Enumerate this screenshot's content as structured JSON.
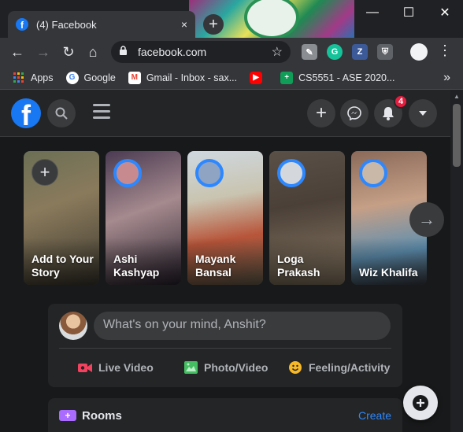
{
  "browser": {
    "tab_count_label": "(4) Facebook",
    "tab_close": "×",
    "new_tab": "+",
    "window": {
      "minimize": "—",
      "maximize": "☐",
      "close": "✕"
    },
    "nav": {
      "back": "←",
      "forward": "→",
      "reload": "↻",
      "home": "⌂"
    },
    "url": "facebook.com",
    "lock_icon": "🔒",
    "star_icon": "☆",
    "menu_icon": "⋮",
    "extensions": [
      {
        "name": "extension-1",
        "glyph": "✎",
        "color": "#8a8d91"
      },
      {
        "name": "grammarly",
        "glyph": "G",
        "color": "#15c39a"
      },
      {
        "name": "z-extension",
        "glyph": "Z",
        "color": "#3d5a98"
      },
      {
        "name": "shield-extension",
        "glyph": "⛨",
        "color": "#5f6368"
      }
    ]
  },
  "bookmarks": {
    "items": [
      {
        "label": "Apps",
        "icon": "apps-grid-icon",
        "color": "#ea4335"
      },
      {
        "label": "Google",
        "icon": "google-icon",
        "color": "#4285f4"
      },
      {
        "label": "Gmail - Inbox - sax...",
        "icon": "gmail-icon",
        "color": "#ea4335"
      },
      {
        "label": "",
        "icon": "youtube-icon",
        "color": "#ff0000"
      },
      {
        "label": "CS5551 - ASE 2020...",
        "icon": "cs-icon",
        "color": "#0f9d58"
      }
    ],
    "overflow": "»"
  },
  "facebook": {
    "logo_glyph": "f",
    "header": {
      "search_icon": "⌕",
      "create_icon": "+",
      "messenger_icon": "✉",
      "notifications_icon": "🔔",
      "notifications_count": "4",
      "account_icon": "▾"
    },
    "stories": [
      {
        "name": "Add to Your Story",
        "is_create": true,
        "bg": "linear-gradient(160deg,#6b6f55 0%,#8a7a5c 40%,#3e3a30 100%)"
      },
      {
        "name": "Ashi Kashyap",
        "bg": "linear-gradient(160deg,#4a3a52 0%,#a58a8e 45%,#2b2430 100%)"
      },
      {
        "name": "Mayank Bansal",
        "bg": "linear-gradient(170deg,#cfd8e0 0%,#c9c4b0 35%,#b7553a 65%,#6d6450 100%)"
      },
      {
        "name": "Loga Prakash",
        "bg": "linear-gradient(170deg,#5a5048 0%,#4b4038 40%,#8c7c66 100%)"
      },
      {
        "name": "Wiz Khalifa",
        "bg": "linear-gradient(170deg,#8b6a5a 0%,#c59f86 40%,#5e8fb0 75%,#3b3d44 100%)"
      }
    ],
    "stories_next": "→",
    "composer": {
      "placeholder": "What's on your mind, Anshit?",
      "actions": [
        {
          "label": "Live Video",
          "color": "#f3425f"
        },
        {
          "label": "Photo/Video",
          "color": "#45bd62"
        },
        {
          "label": "Feeling/Activity",
          "color": "#f7b928"
        }
      ]
    },
    "rooms": {
      "title": "Rooms",
      "create": "Create"
    },
    "new_message": "✎"
  }
}
